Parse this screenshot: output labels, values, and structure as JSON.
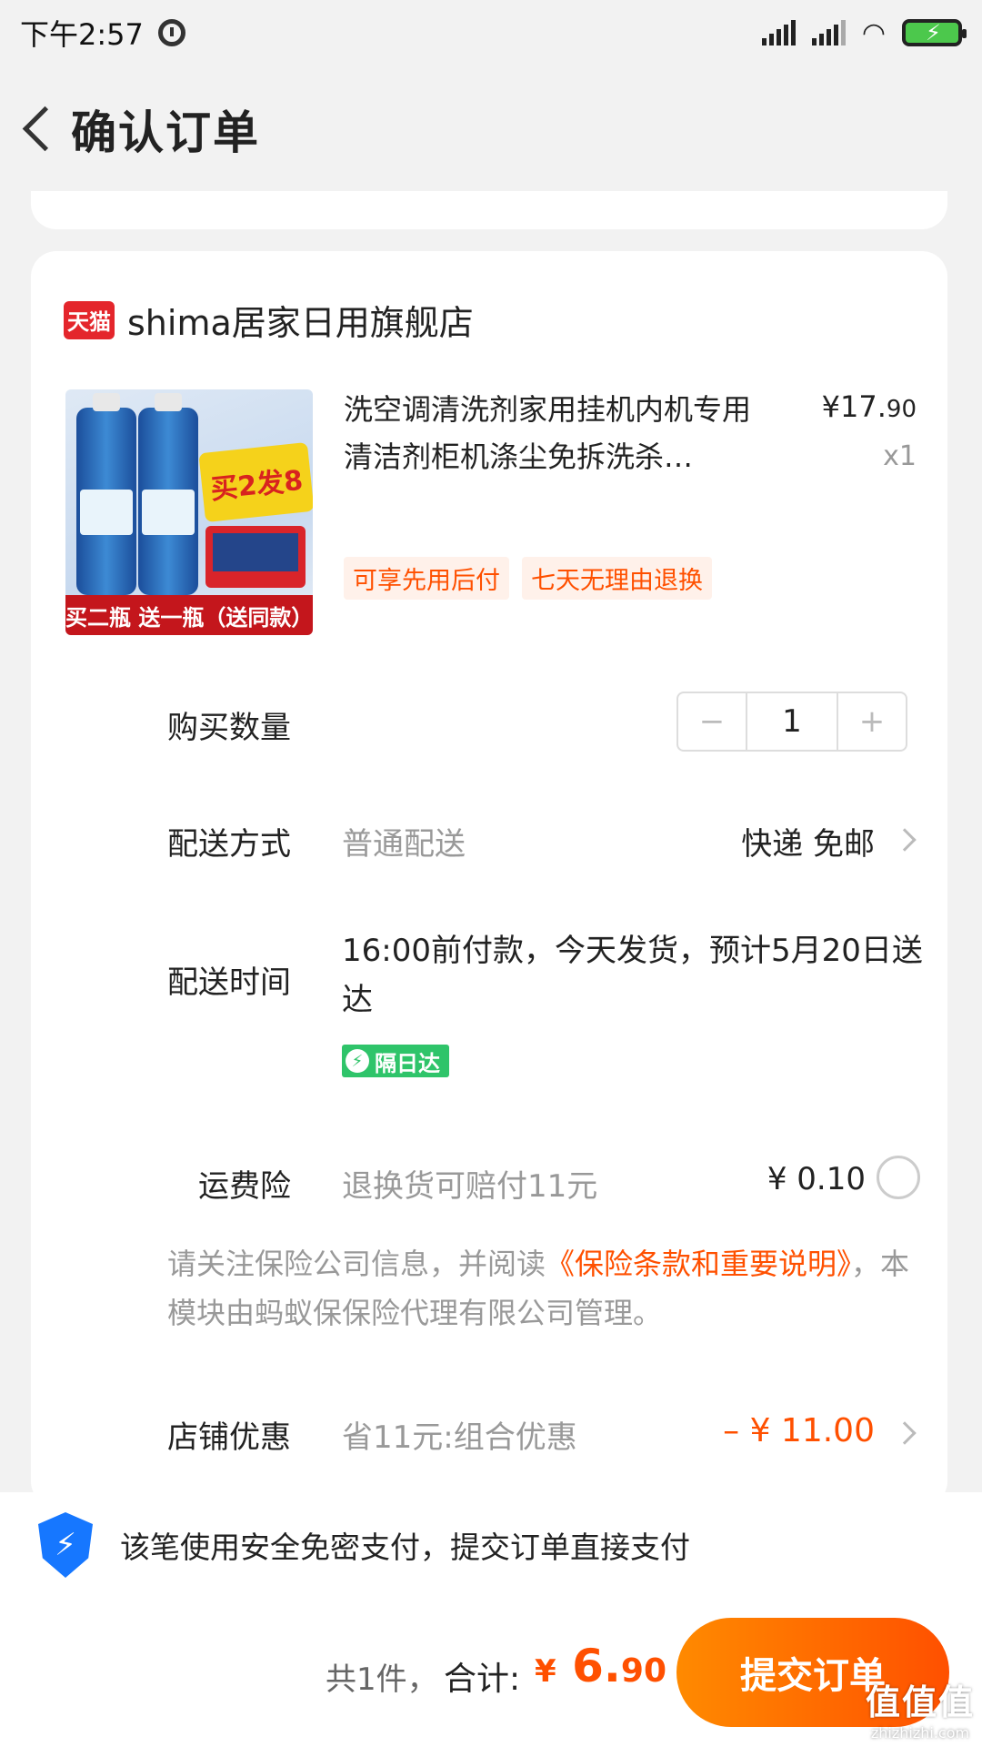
{
  "status_bar": {
    "time": "下午2:57"
  },
  "header": {
    "title": "确认订单"
  },
  "shop": {
    "badge": "天猫",
    "name": "shima居家日用旗舰店"
  },
  "product": {
    "title": "洗空调清洗剂家用挂机内机专用清洁剂柜机涤尘免拆洗杀…",
    "price_main": "¥17.",
    "price_cents": "90",
    "quantity_label": "x1",
    "tags": [
      "可享先用后付",
      "七天无理由退换"
    ],
    "image_texts": {
      "promo": "买2发8",
      "footer": "买二瓶 送一瓶（送同款）"
    }
  },
  "quantity": {
    "label": "购买数量",
    "minus": "−",
    "value": "1",
    "plus": "+"
  },
  "delivery": {
    "label": "配送方式",
    "method": "普通配送",
    "value": "快递 免邮"
  },
  "delivery_time": {
    "label": "配送时间",
    "text": "16:00前付款，今天发货，预计5月20日送达",
    "badge": "隔日达"
  },
  "insurance": {
    "label": "运费险",
    "desc": "退换货可赔付11元",
    "price": "¥ 0.10",
    "note_before": "请关注保险公司信息，并阅读",
    "note_link": "《保险条款和重要说明》",
    "note_after": "，本模块由蚂蚁保保险代理有限公司管理。"
  },
  "discount": {
    "label": "店铺优惠",
    "desc": "省11元:组合优惠",
    "value": "– ¥ 11.00"
  },
  "secure": {
    "text": "该笔使用安全免密支付，提交订单直接支付"
  },
  "checkout": {
    "count": "共1件，",
    "total_label": "合计:",
    "currency": "¥",
    "total_main": "6.",
    "total_cents": "90",
    "submit": "提交订单"
  },
  "watermark": {
    "logo": "值值值",
    "site": "zhizhizhi.com"
  },
  "colors": {
    "accent": "#ff5000",
    "tmall": "#e4262c",
    "secure": "#1677ff",
    "badge_green": "#2fc46a"
  }
}
